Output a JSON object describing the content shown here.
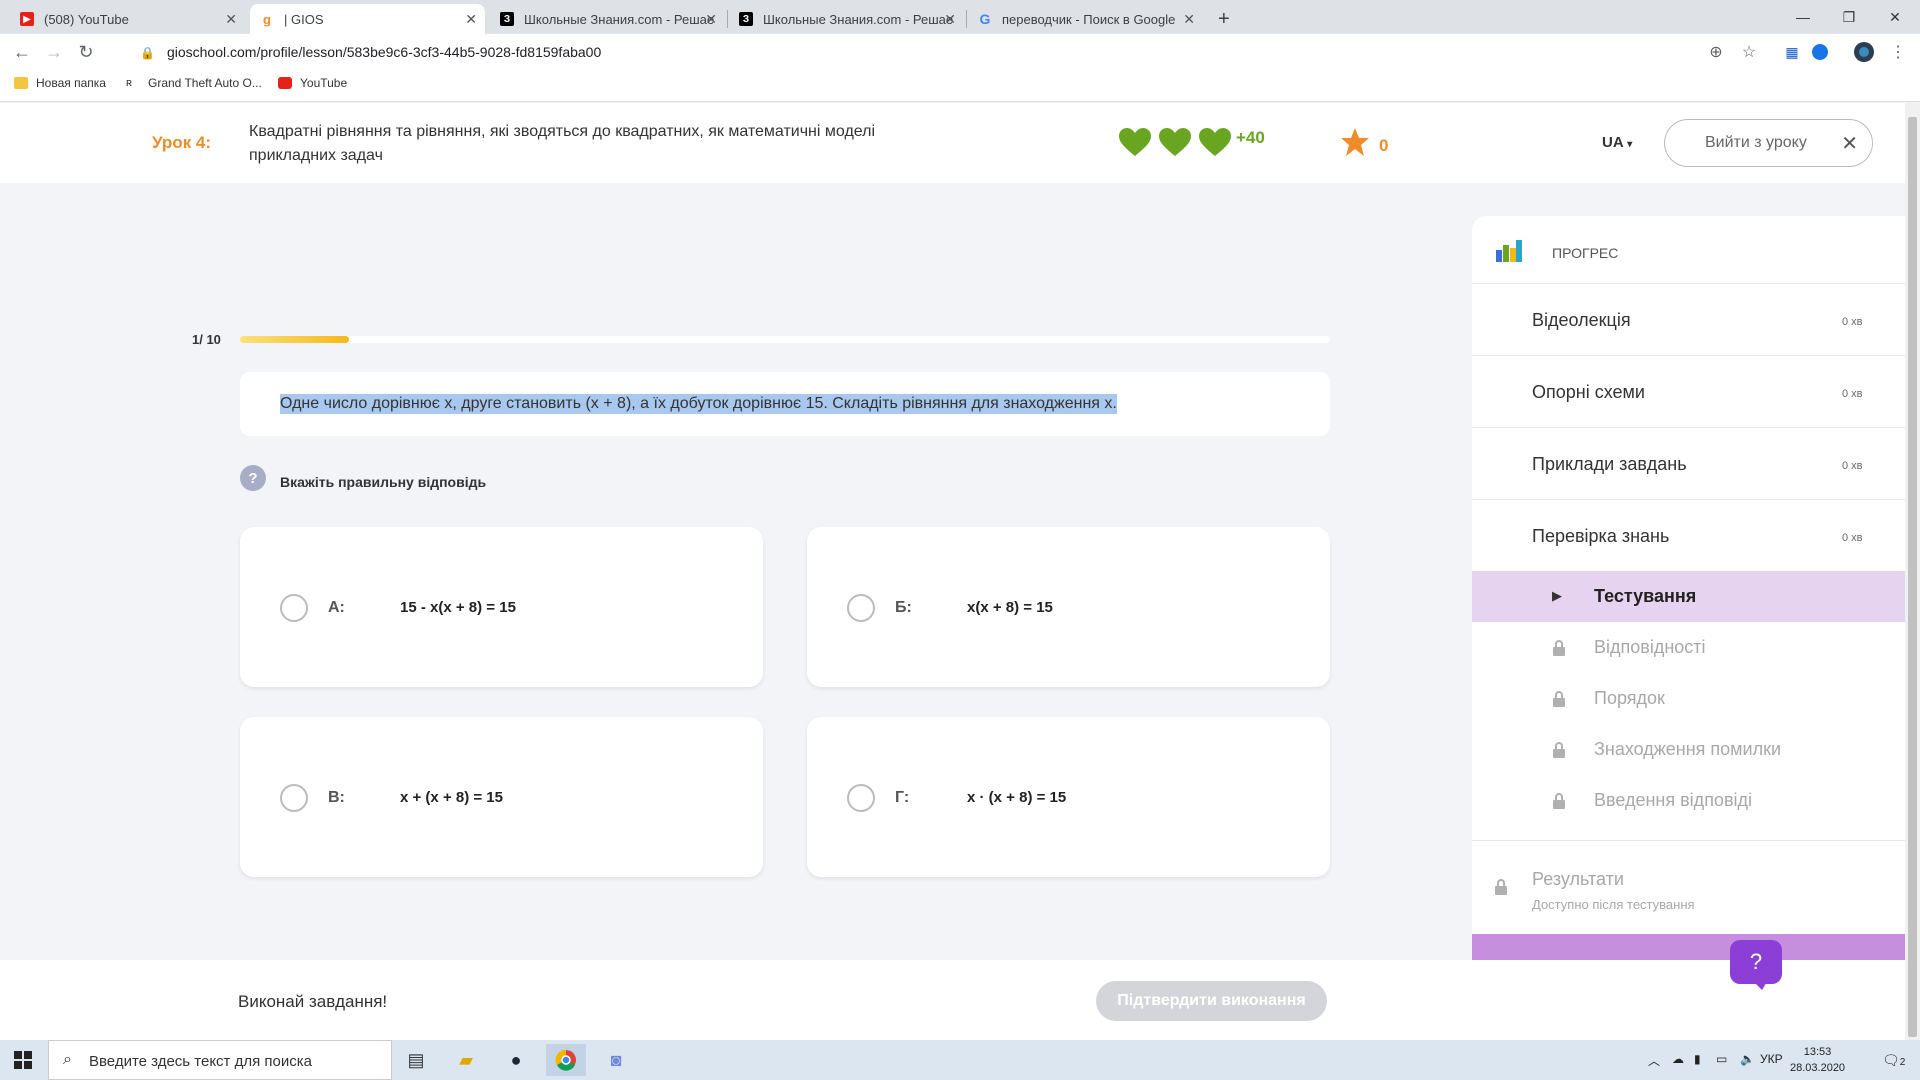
{
  "browser": {
    "tabs": [
      {
        "title": "(508) YouTube",
        "icon": "youtube-icon"
      },
      {
        "title": "| GIOS",
        "icon": "gios-icon"
      },
      {
        "title": "Школьные Знания.com - Решае",
        "icon": "znania-icon"
      },
      {
        "title": "Школьные Знания.com - Решае",
        "icon": "znania-icon"
      },
      {
        "title": "переводчик - Поиск в Google",
        "icon": "google-icon"
      }
    ],
    "url": "gioschool.com/profile/lesson/583be9c6-3cf3-44b5-9028-fd8159faba00",
    "bookmarks": [
      {
        "label": "Новая папка",
        "icon": "folder-icon"
      },
      {
        "label": "Grand Theft Auto O...",
        "icon": "gta-icon"
      },
      {
        "label": "YouTube",
        "icon": "youtube-icon"
      }
    ]
  },
  "lesson": {
    "number": "Урок 4:",
    "title": "Квадратні рівняння та рівняння, які зводяться до квадратних, як математичні моделі прикладних задач",
    "hearts": 3,
    "bonus": "+40",
    "stars": "0",
    "language": "UA",
    "exit_label": "Вийти з уроку"
  },
  "task": {
    "progress_label": "1/ 10",
    "progress_fraction": 0.1,
    "question": "Одне число дорівнює x, друге становить (x + 8), а їх добуток дорівнює 15. Складіть рівняння для знаходження x.",
    "hint": "Вкажіть правильну відповідь",
    "answers": [
      {
        "letter": "А:",
        "formula": "15 - x(x + 8) = 15"
      },
      {
        "letter": "Б:",
        "formula": "x(x + 8) = 15"
      },
      {
        "letter": "В:",
        "formula": "x + (x + 8) = 15"
      },
      {
        "letter": "Г:",
        "formula": "x · (x + 8) = 15"
      }
    ],
    "footer_text": "Виконай завдання!",
    "confirm_label": "Підтвердити виконання"
  },
  "sidebar": {
    "title": "ПРОГРЕС",
    "items": [
      {
        "label": "Відеолекція",
        "time": "0 хв"
      },
      {
        "label": "Опорні схеми",
        "time": "0 хв"
      },
      {
        "label": "Приклади завдань",
        "time": "0 хв"
      },
      {
        "label": "Перевірка знань",
        "time": "0 хв"
      }
    ],
    "subitems": [
      {
        "label": "Тестування",
        "state": "active"
      },
      {
        "label": "Відповідності",
        "state": "locked"
      },
      {
        "label": "Порядок",
        "state": "locked"
      },
      {
        "label": "Знаходження помилки",
        "state": "locked"
      },
      {
        "label": "Введення відповіді",
        "state": "locked"
      }
    ],
    "results_label": "Результати",
    "results_note": "Доступно після тестування"
  },
  "help_label": "?",
  "taskbar": {
    "search_placeholder": "Введите здесь текст для поиска",
    "language": "УКР",
    "time": "13:53",
    "date": "28.03.2020",
    "notifications": "2"
  },
  "colors": {
    "accent_orange": "#f08c28",
    "heart_green": "#6aa521",
    "active_purple": "#e6d3f0",
    "help_purple": "#8b3fd6"
  }
}
